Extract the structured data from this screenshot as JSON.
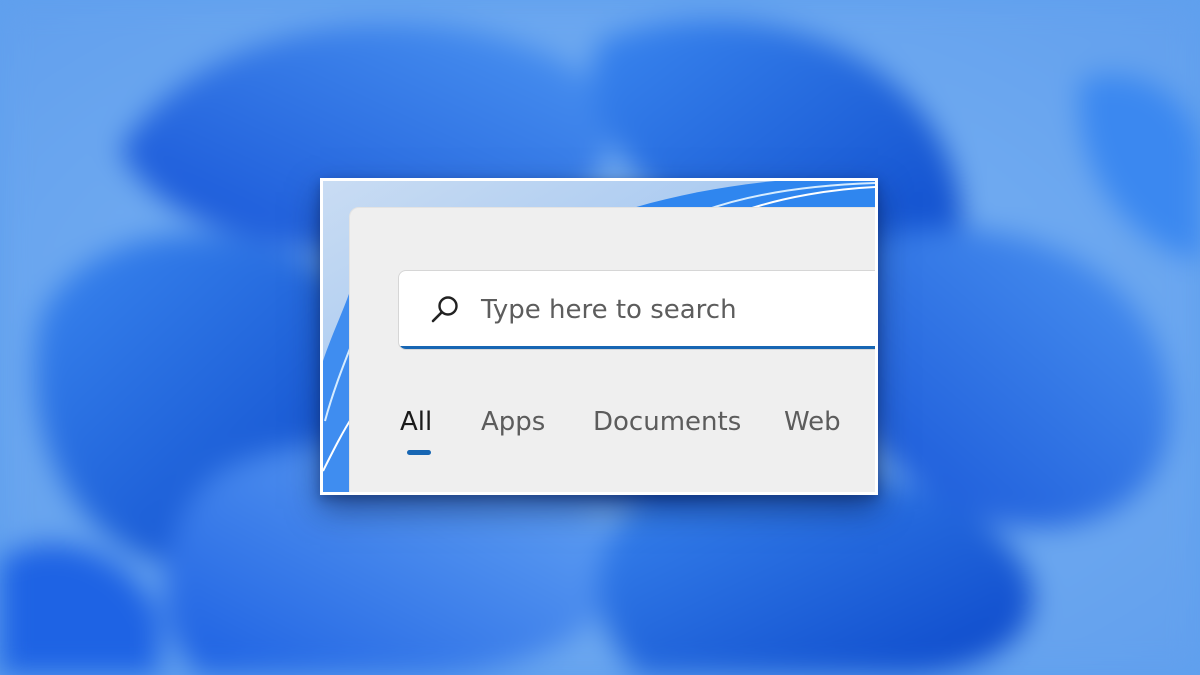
{
  "colors": {
    "accent": "#1766b3",
    "wallpaper_blue": "#1a5fe0",
    "panel_background": "#efefef"
  },
  "search": {
    "icon": "search-icon",
    "placeholder": "Type here to search"
  },
  "tabs": [
    {
      "label": "All",
      "active": true
    },
    {
      "label": "Apps",
      "active": false
    },
    {
      "label": "Documents",
      "active": false
    },
    {
      "label": "Web",
      "active": false
    }
  ]
}
